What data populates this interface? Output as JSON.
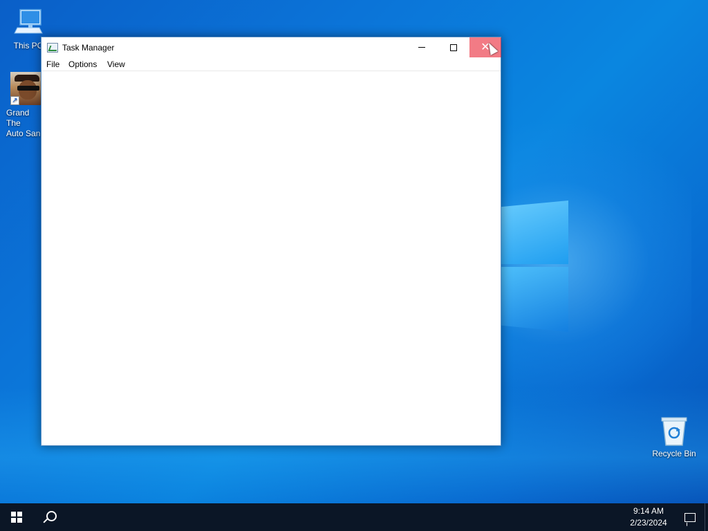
{
  "desktop": {
    "icons": [
      {
        "label": "This PC"
      },
      {
        "label": "Grand Theft Auto San Andreas",
        "label_line1": "Grand The",
        "label_line2": "Auto San"
      },
      {
        "label": "Recycle Bin"
      }
    ]
  },
  "window": {
    "title": "Task Manager",
    "menu": [
      "File",
      "Options",
      "View"
    ],
    "buttons": {
      "minimize_icon": "minimize-icon",
      "maximize_icon": "maximize-icon",
      "close_icon": "close-icon",
      "close_hover_color": "#e81123"
    }
  },
  "taskbar": {
    "time": "9:14 AM",
    "date": "2/23/2024",
    "start_icon": "windows-logo-icon",
    "search_icon": "search-icon",
    "notification_icon": "action-center-icon",
    "background_color": "#0b1626"
  }
}
